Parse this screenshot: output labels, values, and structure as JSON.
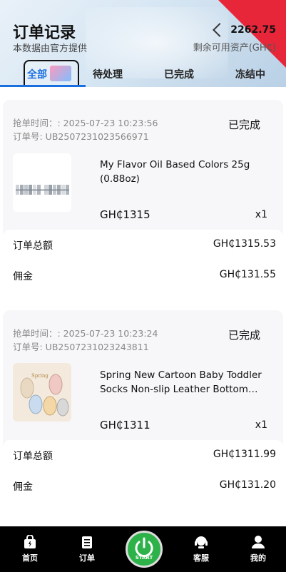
{
  "header": {
    "title": "订单记录",
    "subtitle": "本数据由官方提供",
    "balance": "2262.75",
    "balance_label": "剩余可用资产(GH₵)"
  },
  "tabs": [
    {
      "label": "全部",
      "active": true
    },
    {
      "label": "待处理",
      "active": false
    },
    {
      "label": "已完成",
      "active": false
    },
    {
      "label": "冻结中",
      "active": false
    }
  ],
  "orders": [
    {
      "time": "抢单时间：: 2025-07-23 10:23:56",
      "order_no": "订单号: UB2507231023566971",
      "status": "已完成",
      "product_name": "My Flavor Oil Based Colors 25g (0.88oz)",
      "price": "GH₵1315",
      "qty": "x1",
      "total_label": "订单总额",
      "total": "GH₵1315.53",
      "commission_label": "佣金",
      "commission": "GH₵131.55",
      "thumb_icon": "paint-bottles-image"
    },
    {
      "time": "抢单时间：: 2025-07-23 10:23:24",
      "order_no": "订单号: UB2507231023243811",
      "status": "已完成",
      "product_name": "Spring New Cartoon Baby Toddler Socks Non-slip Leather Bottom Floor Socks",
      "price": "GH₵1311",
      "qty": "x1",
      "total_label": "订单总额",
      "total": "GH₵1311.99",
      "commission_label": "佣金",
      "commission": "GH₵131.20",
      "thumb_icon": "baby-socks-image"
    }
  ],
  "nav": [
    {
      "label": "首页",
      "icon": "home-bag-icon"
    },
    {
      "label": "订单",
      "icon": "order-list-icon"
    },
    {
      "label": "START",
      "icon": "power-icon"
    },
    {
      "label": "客服",
      "icon": "headset-icon"
    },
    {
      "label": "我的",
      "icon": "user-icon"
    }
  ]
}
